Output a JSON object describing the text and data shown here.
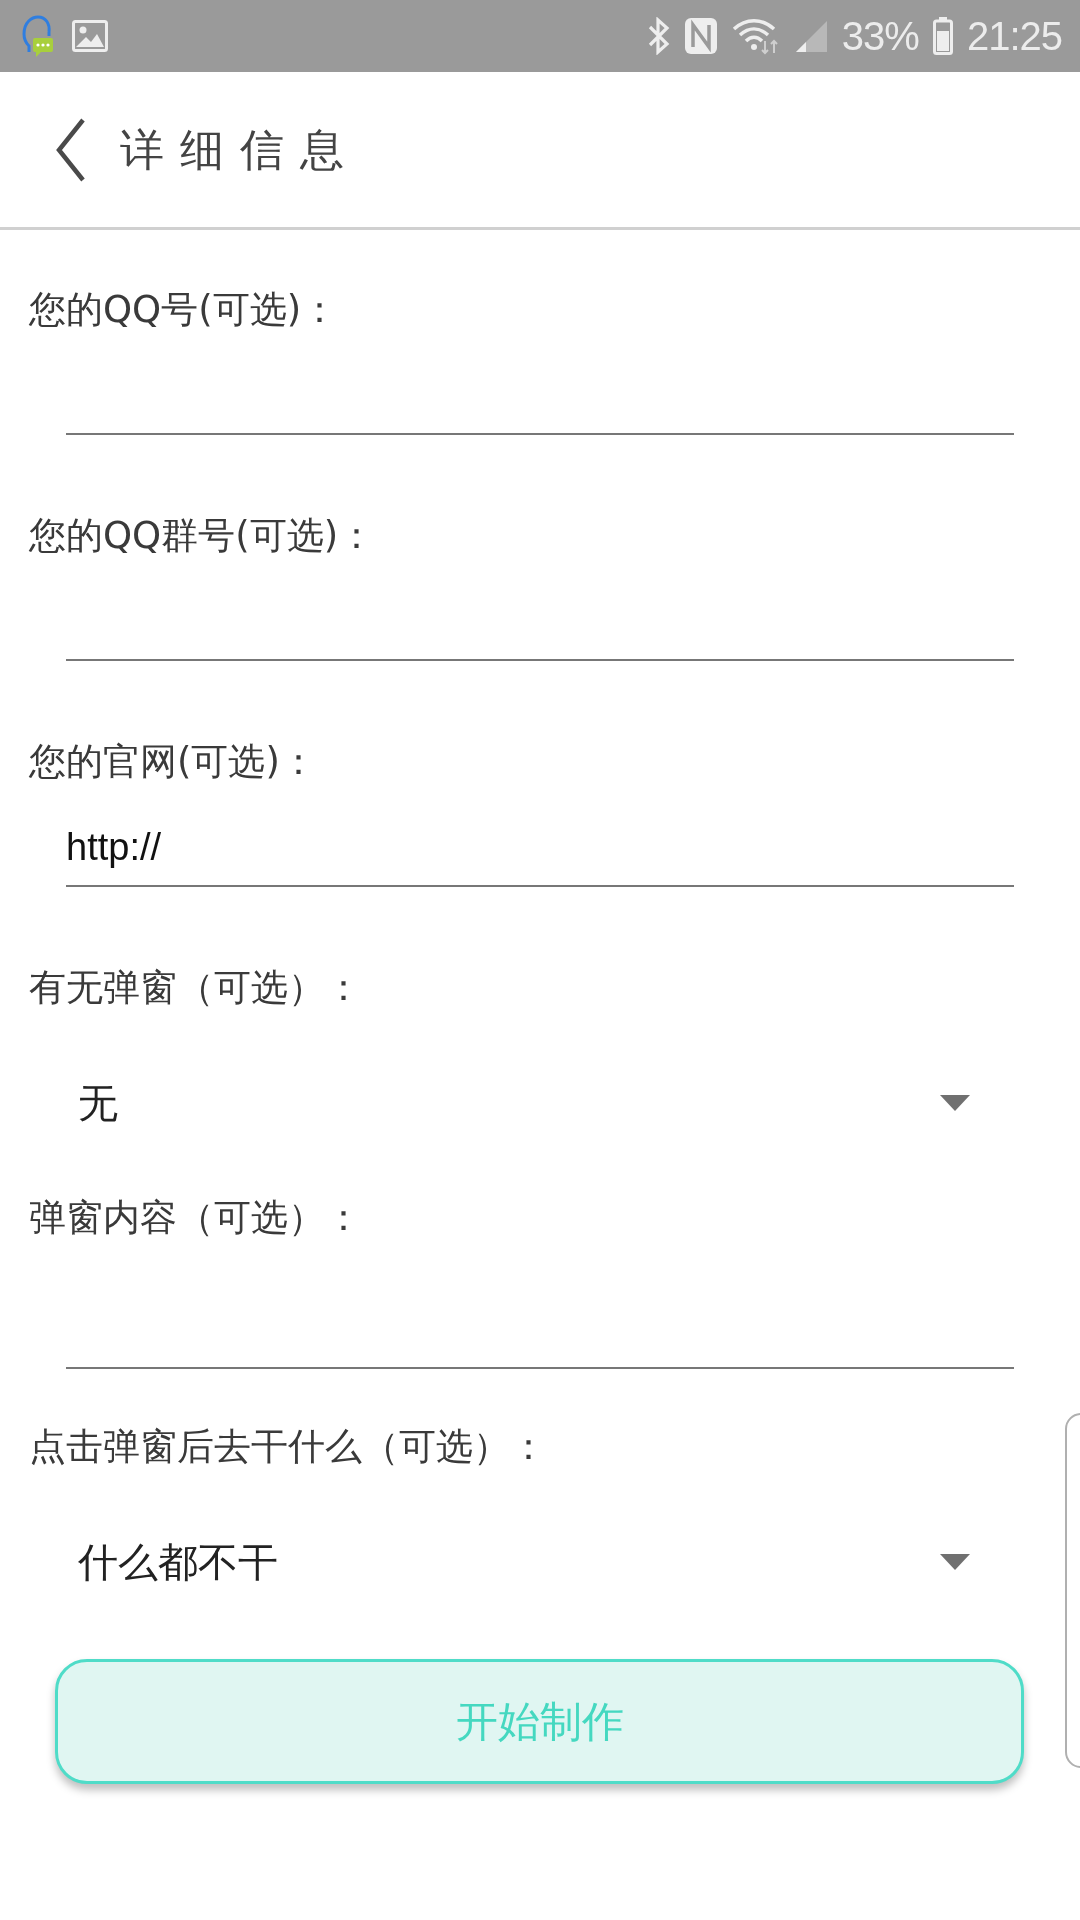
{
  "status_bar": {
    "battery": "33%",
    "time": "21:25"
  },
  "header": {
    "title": "详细信息"
  },
  "fields": [
    {
      "kind": "input",
      "label": "您的QQ号(可选)："
    },
    {
      "kind": "input",
      "label": "您的QQ群号(可选)："
    },
    {
      "kind": "input",
      "label": "您的官网(可选)：",
      "value": "http://"
    },
    {
      "kind": "select",
      "label": "有无弹窗（可选）：",
      "value": "无"
    },
    {
      "kind": "textarea",
      "label": "弹窗内容（可选）："
    },
    {
      "kind": "select",
      "label": "点击弹窗后去干什么（可选）：",
      "value": "什么都不干"
    }
  ],
  "submit_button": {
    "label": "开始制作"
  }
}
